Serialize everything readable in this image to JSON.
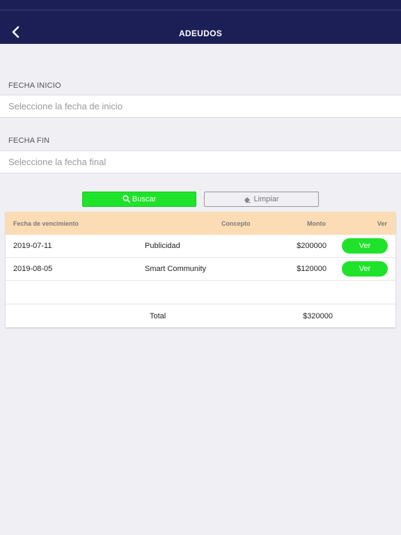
{
  "header": {
    "title": "ADEUDOS"
  },
  "filters": {
    "start": {
      "label": "FECHA INICIO",
      "placeholder": "Seleccione la fecha de inicio"
    },
    "end": {
      "label": "FECHA FIN",
      "placeholder": "Seleccione la fecha final"
    }
  },
  "actions": {
    "search_label": "Buscar",
    "clear_label": "Limpiar"
  },
  "table": {
    "columns": [
      "Fecha de vencimiento",
      "Concepto",
      "Monto",
      "Ver"
    ],
    "rows": [
      {
        "fecha": "2019-07-11",
        "concepto": "Publicidad",
        "monto": "$200000",
        "ver": "Ver"
      },
      {
        "fecha": "2019-08-05",
        "concepto": "Smart Community",
        "monto": "$120000",
        "ver": "Ver"
      }
    ],
    "total_label": "Total",
    "total_value": "$320000"
  },
  "colors": {
    "navbar": "#1b1f55",
    "accent_green": "#1fe32a",
    "header_row": "#fbdcb4"
  },
  "icons": {
    "back": "chevron-left-icon",
    "search": "search-icon",
    "clear": "eraser-icon"
  }
}
